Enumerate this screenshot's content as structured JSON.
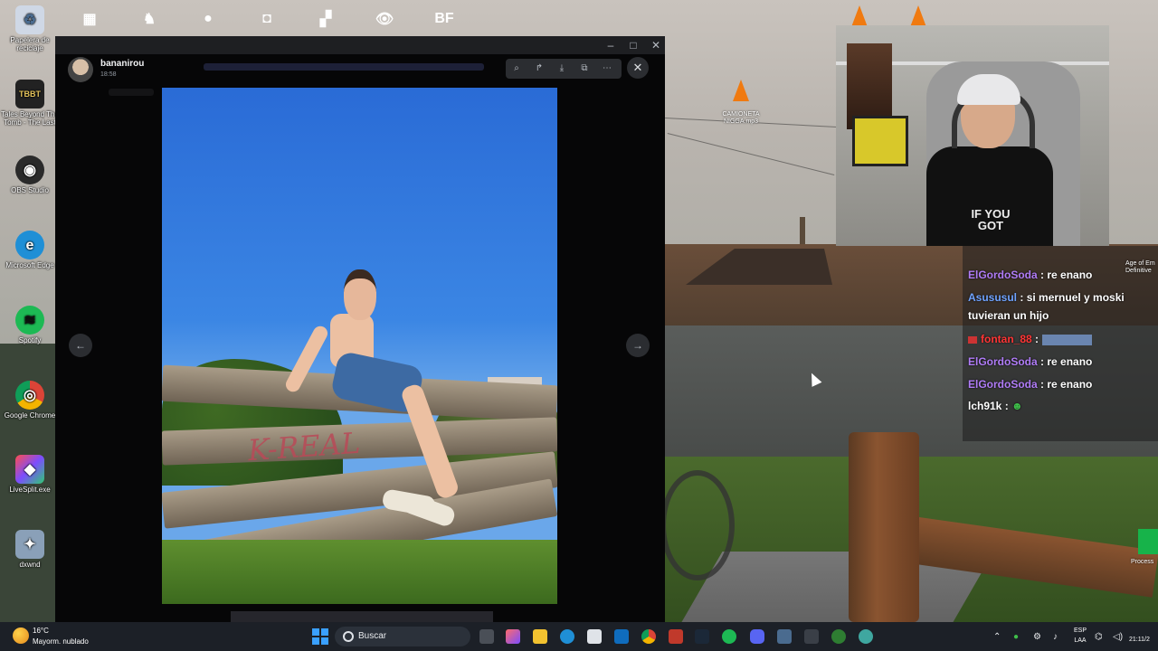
{
  "desktop": {
    "left_icons": [
      {
        "label": "Papelera de reciclaje",
        "color": "#cfd8e6",
        "glyph": "♻"
      },
      {
        "label": "Tales Beyond The Tomb - The Last",
        "color": "#222222",
        "glyph": "TBBT"
      },
      {
        "label": "OBS Studio",
        "color": "#2a2a2a",
        "glyph": "◉"
      },
      {
        "label": "Microsoft Edge",
        "color": "#1f8fd6",
        "glyph": "e"
      },
      {
        "label": "Spotify",
        "color": "#1db954",
        "glyph": "≋"
      },
      {
        "label": "Google Chrome",
        "color": "#db4437",
        "glyph": "◎"
      },
      {
        "label": "LiveSplit.exe",
        "color": "#7c4dff",
        "glyph": "◆"
      },
      {
        "label": "dxwnd",
        "color": "#8aa0b8",
        "glyph": "✦"
      }
    ],
    "top_icons": [
      {
        "color": "#3b6fd6",
        "glyph": "▦"
      },
      {
        "color": "#d9822b",
        "glyph": "♞"
      },
      {
        "color": "#e26b1a",
        "glyph": "●"
      },
      {
        "color": "#3b62e6",
        "glyph": "◘"
      },
      {
        "color": "#c0392b",
        "glyph": "▞"
      },
      {
        "color": "#111111",
        "glyph": "👁"
      },
      {
        "color": "#111111",
        "glyph": "BF"
      }
    ],
    "cone_label": "CAMIONETA NIGGA.mp3"
  },
  "discord": {
    "username": "bananirou",
    "timestamp": "18:58",
    "toolbar_icons": [
      "zoom-icon",
      "forward-icon",
      "download-icon",
      "open-external-icon",
      "more-icon"
    ],
    "close_glyph": "✕",
    "prev_glyph": "←",
    "next_glyph": "→",
    "photo_graffiti": "K-REAL"
  },
  "chat": {
    "messages": [
      {
        "user": "ElGordoSoda",
        "text": ": re enano",
        "color": "purple"
      },
      {
        "user": "Asususul",
        "text": ": si mernuel y moski tuvieran un hijo",
        "color": "blue"
      },
      {
        "user": "fontan_88",
        "text": ":",
        "color": "red",
        "emote": true
      },
      {
        "user": "ElGordoSoda",
        "text": ": re enano",
        "color": "purple"
      },
      {
        "user": "ElGordoSoda",
        "text": ": re enano",
        "color": "purple"
      },
      {
        "user": "lch91k",
        "text": ":",
        "color": "white",
        "emote_small": true
      }
    ],
    "age_label": "Age of Em Definitive",
    "process_label": "Process"
  },
  "webcam": {
    "shirt_text": "IF YOU GOT"
  },
  "taskbar": {
    "weather_temp": "16°C",
    "weather_desc": "Mayorm. nublado",
    "search_placeholder": "Buscar",
    "lang_top": "ESP",
    "lang_bottom": "LAA",
    "clock": "21:11/2"
  }
}
